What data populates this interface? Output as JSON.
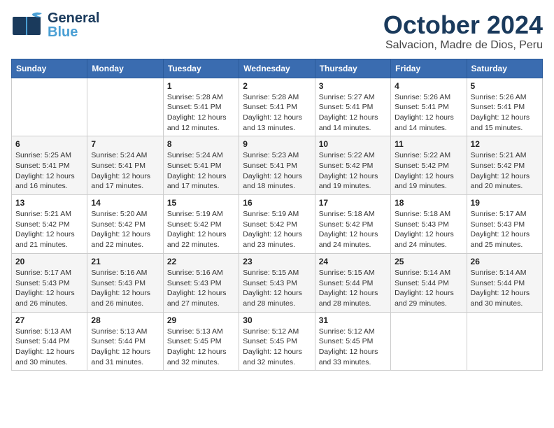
{
  "header": {
    "logo_line1": "General",
    "logo_line2": "Blue",
    "month": "October 2024",
    "location": "Salvacion, Madre de Dios, Peru"
  },
  "weekdays": [
    "Sunday",
    "Monday",
    "Tuesday",
    "Wednesday",
    "Thursday",
    "Friday",
    "Saturday"
  ],
  "weeks": [
    [
      {
        "day": "",
        "info": ""
      },
      {
        "day": "",
        "info": ""
      },
      {
        "day": "1",
        "info": "Sunrise: 5:28 AM\nSunset: 5:41 PM\nDaylight: 12 hours\nand 12 minutes."
      },
      {
        "day": "2",
        "info": "Sunrise: 5:28 AM\nSunset: 5:41 PM\nDaylight: 12 hours\nand 13 minutes."
      },
      {
        "day": "3",
        "info": "Sunrise: 5:27 AM\nSunset: 5:41 PM\nDaylight: 12 hours\nand 14 minutes."
      },
      {
        "day": "4",
        "info": "Sunrise: 5:26 AM\nSunset: 5:41 PM\nDaylight: 12 hours\nand 14 minutes."
      },
      {
        "day": "5",
        "info": "Sunrise: 5:26 AM\nSunset: 5:41 PM\nDaylight: 12 hours\nand 15 minutes."
      }
    ],
    [
      {
        "day": "6",
        "info": "Sunrise: 5:25 AM\nSunset: 5:41 PM\nDaylight: 12 hours\nand 16 minutes."
      },
      {
        "day": "7",
        "info": "Sunrise: 5:24 AM\nSunset: 5:41 PM\nDaylight: 12 hours\nand 17 minutes."
      },
      {
        "day": "8",
        "info": "Sunrise: 5:24 AM\nSunset: 5:41 PM\nDaylight: 12 hours\nand 17 minutes."
      },
      {
        "day": "9",
        "info": "Sunrise: 5:23 AM\nSunset: 5:41 PM\nDaylight: 12 hours\nand 18 minutes."
      },
      {
        "day": "10",
        "info": "Sunrise: 5:22 AM\nSunset: 5:42 PM\nDaylight: 12 hours\nand 19 minutes."
      },
      {
        "day": "11",
        "info": "Sunrise: 5:22 AM\nSunset: 5:42 PM\nDaylight: 12 hours\nand 19 minutes."
      },
      {
        "day": "12",
        "info": "Sunrise: 5:21 AM\nSunset: 5:42 PM\nDaylight: 12 hours\nand 20 minutes."
      }
    ],
    [
      {
        "day": "13",
        "info": "Sunrise: 5:21 AM\nSunset: 5:42 PM\nDaylight: 12 hours\nand 21 minutes."
      },
      {
        "day": "14",
        "info": "Sunrise: 5:20 AM\nSunset: 5:42 PM\nDaylight: 12 hours\nand 22 minutes."
      },
      {
        "day": "15",
        "info": "Sunrise: 5:19 AM\nSunset: 5:42 PM\nDaylight: 12 hours\nand 22 minutes."
      },
      {
        "day": "16",
        "info": "Sunrise: 5:19 AM\nSunset: 5:42 PM\nDaylight: 12 hours\nand 23 minutes."
      },
      {
        "day": "17",
        "info": "Sunrise: 5:18 AM\nSunset: 5:42 PM\nDaylight: 12 hours\nand 24 minutes."
      },
      {
        "day": "18",
        "info": "Sunrise: 5:18 AM\nSunset: 5:43 PM\nDaylight: 12 hours\nand 24 minutes."
      },
      {
        "day": "19",
        "info": "Sunrise: 5:17 AM\nSunset: 5:43 PM\nDaylight: 12 hours\nand 25 minutes."
      }
    ],
    [
      {
        "day": "20",
        "info": "Sunrise: 5:17 AM\nSunset: 5:43 PM\nDaylight: 12 hours\nand 26 minutes."
      },
      {
        "day": "21",
        "info": "Sunrise: 5:16 AM\nSunset: 5:43 PM\nDaylight: 12 hours\nand 26 minutes."
      },
      {
        "day": "22",
        "info": "Sunrise: 5:16 AM\nSunset: 5:43 PM\nDaylight: 12 hours\nand 27 minutes."
      },
      {
        "day": "23",
        "info": "Sunrise: 5:15 AM\nSunset: 5:43 PM\nDaylight: 12 hours\nand 28 minutes."
      },
      {
        "day": "24",
        "info": "Sunrise: 5:15 AM\nSunset: 5:44 PM\nDaylight: 12 hours\nand 28 minutes."
      },
      {
        "day": "25",
        "info": "Sunrise: 5:14 AM\nSunset: 5:44 PM\nDaylight: 12 hours\nand 29 minutes."
      },
      {
        "day": "26",
        "info": "Sunrise: 5:14 AM\nSunset: 5:44 PM\nDaylight: 12 hours\nand 30 minutes."
      }
    ],
    [
      {
        "day": "27",
        "info": "Sunrise: 5:13 AM\nSunset: 5:44 PM\nDaylight: 12 hours\nand 30 minutes."
      },
      {
        "day": "28",
        "info": "Sunrise: 5:13 AM\nSunset: 5:44 PM\nDaylight: 12 hours\nand 31 minutes."
      },
      {
        "day": "29",
        "info": "Sunrise: 5:13 AM\nSunset: 5:45 PM\nDaylight: 12 hours\nand 32 minutes."
      },
      {
        "day": "30",
        "info": "Sunrise: 5:12 AM\nSunset: 5:45 PM\nDaylight: 12 hours\nand 32 minutes."
      },
      {
        "day": "31",
        "info": "Sunrise: 5:12 AM\nSunset: 5:45 PM\nDaylight: 12 hours\nand 33 minutes."
      },
      {
        "day": "",
        "info": ""
      },
      {
        "day": "",
        "info": ""
      }
    ]
  ]
}
